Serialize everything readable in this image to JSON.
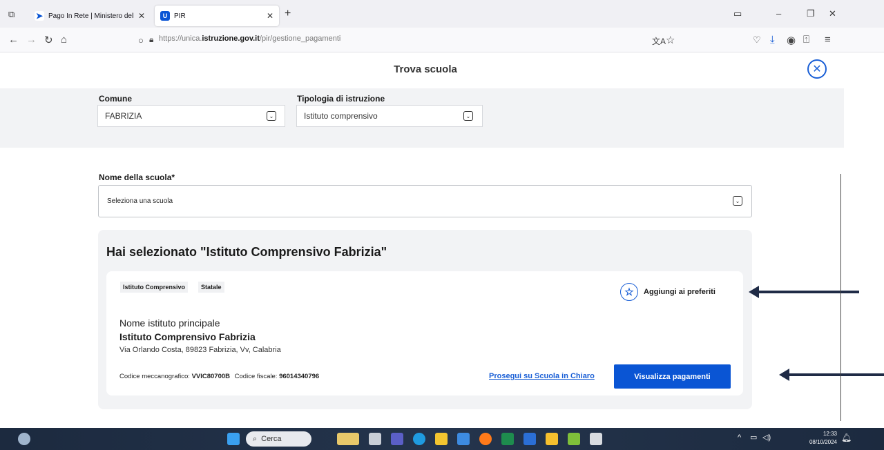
{
  "browser": {
    "tabs": [
      {
        "title": "Pago In Rete | Ministero dell'Istr",
        "favicon": "P"
      },
      {
        "title": "PIR",
        "favicon": "U"
      }
    ],
    "url_prefix": "https://unica.",
    "url_host": "istruzione.gov.it",
    "url_path": "/pir/gestione_pagamenti"
  },
  "modal": {
    "title": "Trova scuola",
    "close_icon": "✕"
  },
  "filters": {
    "comune_label": "Comune",
    "comune_value": "FABRIZIA",
    "tipologia_label": "Tipologia di istruzione",
    "tipologia_value": "Istituto comprensivo"
  },
  "school": {
    "label": "Nome della scuola*",
    "placeholder": "Seleziona una scuola"
  },
  "selection": {
    "title": "Hai selezionato \"Istituto Comprensivo Fabrizia\"",
    "badges": [
      "Istituto Comprensivo",
      "Statale"
    ],
    "favorite_label": "Aggiungi ai preferiti",
    "principal_label": "Nome istituto principale",
    "principal_name": "Istituto Comprensivo Fabrizia",
    "address": "Via Orlando Costa, 89823 Fabrizia, Vv, Calabria",
    "codice_mecc_label": "Codice meccanografico:",
    "codice_mecc_value": "VVIC80700B",
    "codice_fisc_label": "Codice fiscale:",
    "codice_fisc_value": "96014340796",
    "link_label": "Prosegui su Scuola in Chiaro",
    "button_label": "Visualizza pagamenti"
  },
  "taskbar": {
    "search_label": "Cerca",
    "time": "12:33",
    "date": "08/10/2024"
  },
  "colors": {
    "accent": "#0a55d4",
    "arrow": "#1f2b46",
    "panel": "#f2f3f5"
  }
}
